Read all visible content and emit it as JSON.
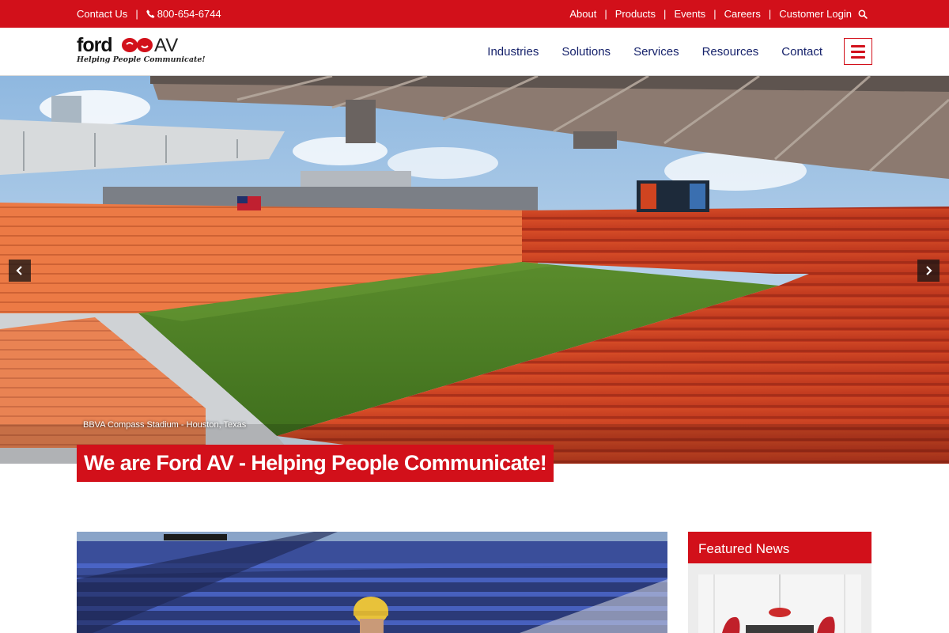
{
  "topbar": {
    "contact_label": "Contact Us",
    "separator": "|",
    "phone": "800-654-6744",
    "links": [
      "About",
      "Products",
      "Events",
      "Careers",
      "Customer Login"
    ]
  },
  "logo": {
    "word": "ford",
    "suffix": "AV",
    "tagline": "Helping People Communicate!"
  },
  "nav": {
    "items": [
      "Industries",
      "Solutions",
      "Services",
      "Resources",
      "Contact"
    ]
  },
  "hero": {
    "caption": "BBVA Compass Stadium - Houston, Texas",
    "headline": "We are Ford AV - Helping People Communicate!"
  },
  "sidebar": {
    "featured_title": "Featured News"
  },
  "colors": {
    "brand_red": "#d2101a",
    "nav_blue": "#16226b"
  },
  "icons": [
    "phone-icon",
    "search-icon",
    "hamburger-menu-icon",
    "chevron-left-icon",
    "chevron-right-icon"
  ]
}
